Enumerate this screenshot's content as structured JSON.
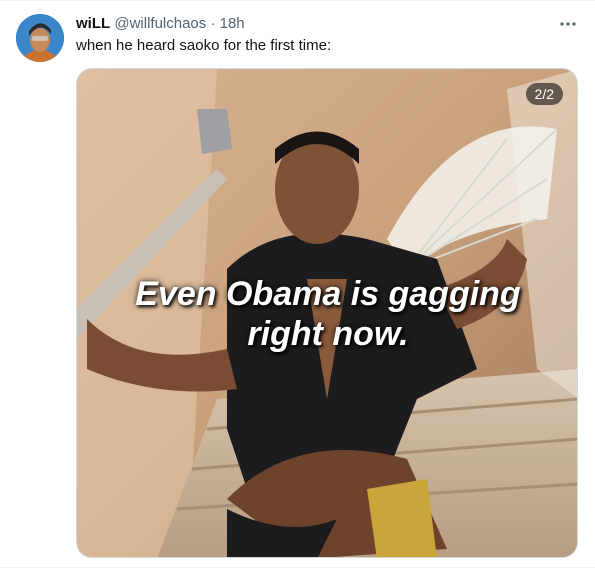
{
  "tweet": {
    "display_name": "wiLL",
    "handle": "@willfulchaos",
    "separator": "·",
    "time": "18h",
    "text": "when he heard saoko for the first time:",
    "more_icon": "more-horizontal-icon"
  },
  "media": {
    "counter": "2/2",
    "caption_line1": "Even Obama is gagging",
    "caption_line2": "right now."
  }
}
